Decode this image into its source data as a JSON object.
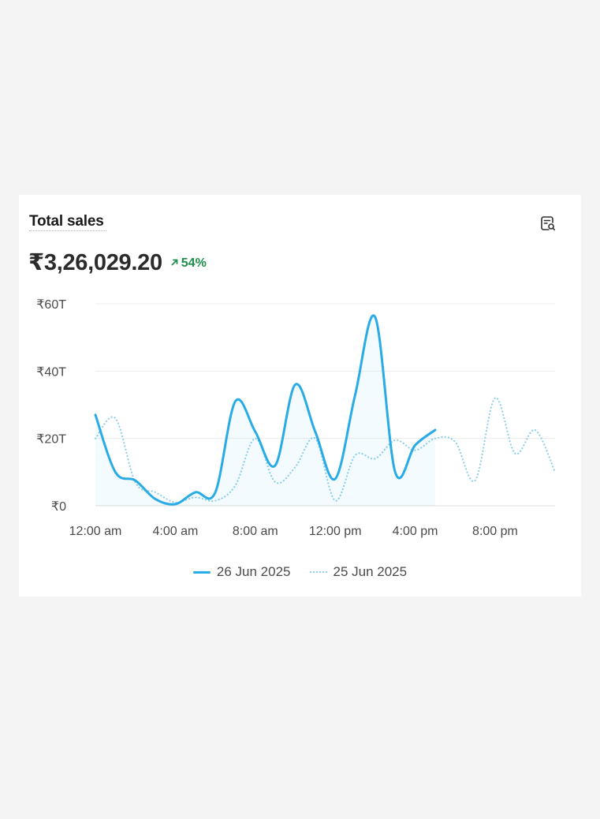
{
  "card": {
    "title": "Total sales",
    "metric_value": "₹3,26,029.20",
    "delta_text": "54%",
    "delta_direction": "up",
    "delta_color": "#1f8f4e",
    "report_icon": "chart-report-icon"
  },
  "chart_data": {
    "type": "line",
    "x": [
      "12:00 am",
      "1:00 am",
      "2:00 am",
      "3:00 am",
      "4:00 am",
      "5:00 am",
      "6:00 am",
      "7:00 am",
      "8:00 am",
      "9:00 am",
      "10:00 am",
      "11:00 am",
      "12:00 pm",
      "1:00 pm",
      "2:00 pm",
      "3:00 pm",
      "4:00 pm",
      "5:00 pm",
      "6:00 pm",
      "7:00 pm",
      "8:00 pm",
      "9:00 pm",
      "10:00 pm",
      "11:00 pm"
    ],
    "x_tick_labels": [
      "12:00 am",
      "4:00 am",
      "8:00 am",
      "12:00 pm",
      "4:00 pm",
      "8:00 pm"
    ],
    "y_tick_labels": [
      "₹0",
      "₹20T",
      "₹40T",
      "₹60T"
    ],
    "y_ticks": [
      0,
      20,
      40,
      60
    ],
    "ylim": [
      0,
      60
    ],
    "grid": true,
    "series": [
      {
        "name": "26 Jun 2025",
        "style": "solid",
        "color": "#29abe6",
        "values": [
          27,
          10,
          7.5,
          2,
          0.5,
          4,
          4,
          31,
          22,
          12,
          36,
          22,
          8,
          33,
          56,
          10,
          18,
          22.5,
          null,
          null,
          null,
          null,
          null,
          null
        ]
      },
      {
        "name": "25 Jun 2025",
        "style": "dotted",
        "color": "#8fd0ec",
        "values": [
          20,
          26,
          7,
          4,
          1,
          2.5,
          1.5,
          6,
          20,
          7,
          11.5,
          20,
          1.5,
          15,
          14,
          19.5,
          16.5,
          20,
          19,
          7.5,
          32,
          15.5,
          22.5,
          10
        ]
      }
    ],
    "legend_position": "bottom"
  }
}
